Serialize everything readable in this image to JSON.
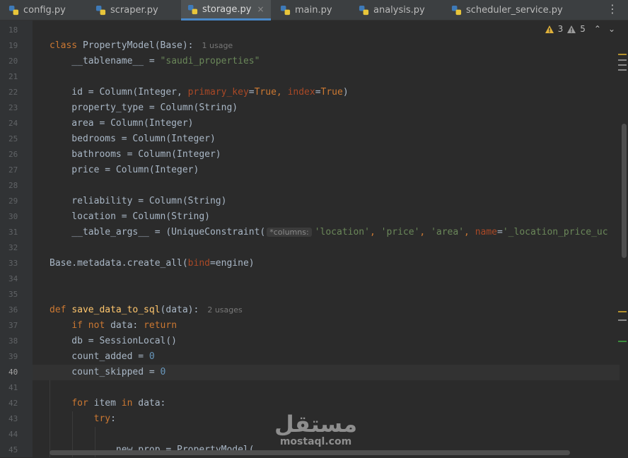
{
  "tabs": [
    {
      "label": "config.py",
      "active": false
    },
    {
      "label": "scraper.py",
      "active": false
    },
    {
      "label": "storage.py",
      "active": true
    },
    {
      "label": "main.py",
      "active": false
    },
    {
      "label": "analysis.py",
      "active": false
    },
    {
      "label": "scheduler_service.py",
      "active": false
    }
  ],
  "tab_close_glyph": "×",
  "tab_menu_glyph": "⋮",
  "inspection": {
    "warnings": "3",
    "weak_warnings": "5",
    "prev": "⌃",
    "next": "⌄"
  },
  "lines": [
    "18",
    "19",
    "20",
    "21",
    "22",
    "23",
    "24",
    "25",
    "26",
    "27",
    "28",
    "29",
    "30",
    "31",
    "32",
    "33",
    "34",
    "35",
    "36",
    "37",
    "38",
    "39",
    "40",
    "41",
    "42",
    "43",
    "44",
    "45"
  ],
  "current_line": "40",
  "code": {
    "l19_kw": "class",
    "l19_rest": " PropertyModel(Base):",
    "l19_usage": "1 usage",
    "l20_name": "    __tablename__ = ",
    "l20_str": "\"saudi_properties\"",
    "l22_a": "    id = Column(Integer, ",
    "l22_p1": "primary_key",
    "l22_eq1": "=",
    "l22_v1": "True",
    "l22_comma": ", ",
    "l22_p2": "index",
    "l22_eq2": "=",
    "l22_v2": "True",
    "l22_end": ")",
    "l23": "    property_type = Column(String)",
    "l24": "    area = Column(Integer)",
    "l25": "    bedrooms = Column(Integer)",
    "l26": "    bathrooms = Column(Integer)",
    "l27": "    price = Column(Integer)",
    "l29": "    reliability = Column(String)",
    "l30": "    location = Column(String)",
    "l31_a": "    __table_args__ = (UniqueConstraint(",
    "l31_hint": "*columns:",
    "l31_s1": "'location'",
    "l31_c1": ", ",
    "l31_s2": "'price'",
    "l31_c2": ", ",
    "l31_s3": "'area'",
    "l31_c3": ", ",
    "l31_p": "name",
    "l31_eq": "=",
    "l31_s4": "'_location_price_uc",
    "l33_a": "Base.metadata.create_all(",
    "l33_p": "bind",
    "l33_b": "=engine)",
    "l36_kw": "def",
    "l36_fn": "save_data_to_sql",
    "l36_rest": "(data):",
    "l36_usage": "2 usages",
    "l37_kw1": "if not",
    "l37_mid": " data: ",
    "l37_kw2": "return",
    "l38": "    db = SessionLocal()",
    "l39_a": "    count_added = ",
    "l39_n": "0",
    "l40_a": "    count_skipped = ",
    "l40_n": "0",
    "l42_kw1": "for",
    "l42_mid": " item ",
    "l42_kw2": "in",
    "l42_end": " data:",
    "l43_kw": "try",
    "l43_end": ":",
    "l45": "            new_prop = PropertyModel("
  },
  "watermark": {
    "arabic": "مستقل",
    "latin": "mostaql.com"
  },
  "colors": {
    "keyword": "#cc7832",
    "string": "#6a8759",
    "number": "#6897bb",
    "function": "#ffc66d",
    "param": "#aa4926",
    "text": "#a9b7c6",
    "background": "#2b2b2b"
  }
}
